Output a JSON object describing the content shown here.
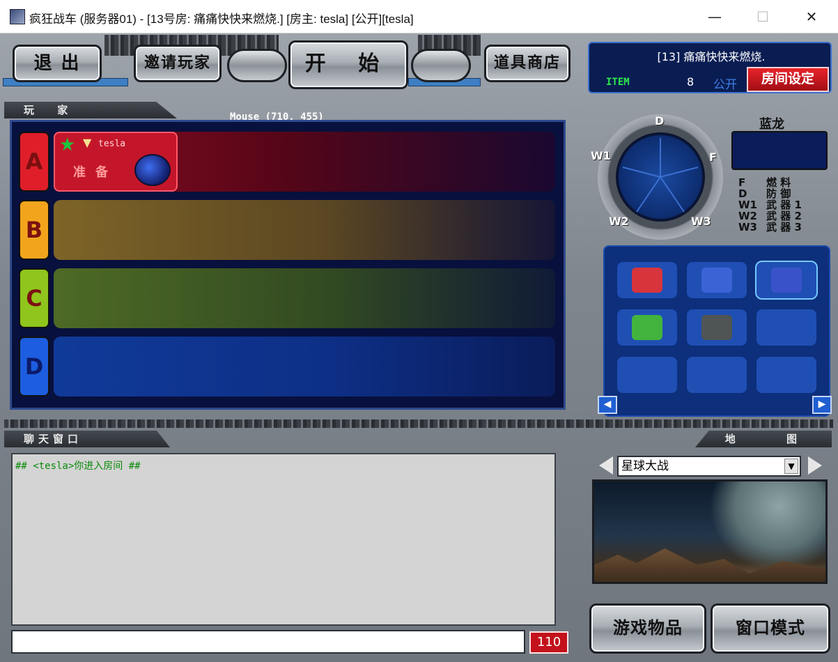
{
  "window": {
    "title": "疯狂战车 (服务器01) - [13号房: 痛痛快快来燃烧.] [房主: tesla] [公开][tesla]",
    "minimize_glyph": "—",
    "maximize_glyph": "☐",
    "close_glyph": "✕"
  },
  "top_buttons": {
    "exit": "退 出",
    "invite": "邀请玩家",
    "start": "开 始",
    "shop": "道具商店"
  },
  "room": {
    "title": "[13] 痛痛快快来燃烧.",
    "item_label": "ITEM",
    "item_count": "8",
    "visibility": "公开",
    "settings_button": "房间设定"
  },
  "players_section": {
    "tab_label": "玩 家",
    "mouse_readout": "Mouse (710, 455)",
    "teams": [
      {
        "letter": "A",
        "color": "#e01e2a"
      },
      {
        "letter": "B",
        "color": "#f2a51c"
      },
      {
        "letter": "C",
        "color": "#8fc51c"
      },
      {
        "letter": "D",
        "color": "#1d5ee0"
      }
    ],
    "player": {
      "name": "tesla",
      "status": "准备",
      "star_glyph": "★",
      "rank_glyph": "▼"
    }
  },
  "character": {
    "name": "蓝龙",
    "dial_labels": {
      "top": "D",
      "left": "W1",
      "right": "F",
      "bottom_left": "W2",
      "bottom_right": "W3"
    },
    "stats": [
      {
        "key": "F",
        "label": "燃 料"
      },
      {
        "key": "D",
        "label": "防 御"
      },
      {
        "key": "W1",
        "label": "武 器 1"
      },
      {
        "key": "W2",
        "label": "武 器 2"
      },
      {
        "key": "W3",
        "label": "武 器 3"
      }
    ],
    "slots": [
      {
        "icon": "red-robot-icon",
        "color": "#d8343c"
      },
      {
        "icon": "blue-robot-icon",
        "color": "#3b63d6"
      },
      {
        "icon": "blue-dragon-icon",
        "color": "#3a52c9",
        "selected": true
      },
      {
        "icon": "green-mech-icon",
        "color": "#42b43d"
      },
      {
        "icon": "rock-golem-icon",
        "color": "#4f5554"
      },
      {
        "icon": "empty-slot-icon",
        "color": "#2456bb"
      },
      {
        "icon": "empty-slot-icon",
        "color": "#2456bb"
      },
      {
        "icon": "empty-slot-icon",
        "color": "#2456bb"
      },
      {
        "icon": "empty-slot-icon",
        "color": "#2456bb"
      }
    ],
    "prev_glyph": "◀",
    "next_glyph": "▶"
  },
  "chat": {
    "tab_label": "聊天窗口",
    "messages": [
      "## <tesla>你进入房间 ##"
    ],
    "input_value": "",
    "char_count": "110"
  },
  "map": {
    "tab_label": "地 图",
    "selected": "星球大战",
    "dropdown_glyph": "▼"
  },
  "bottom_buttons": {
    "items": "游戏物品",
    "window_mode": "窗口模式"
  },
  "colors": {
    "accent_red": "#c3121b",
    "panel_blue": "#08103d",
    "chat_green": "#0a8a0a"
  }
}
